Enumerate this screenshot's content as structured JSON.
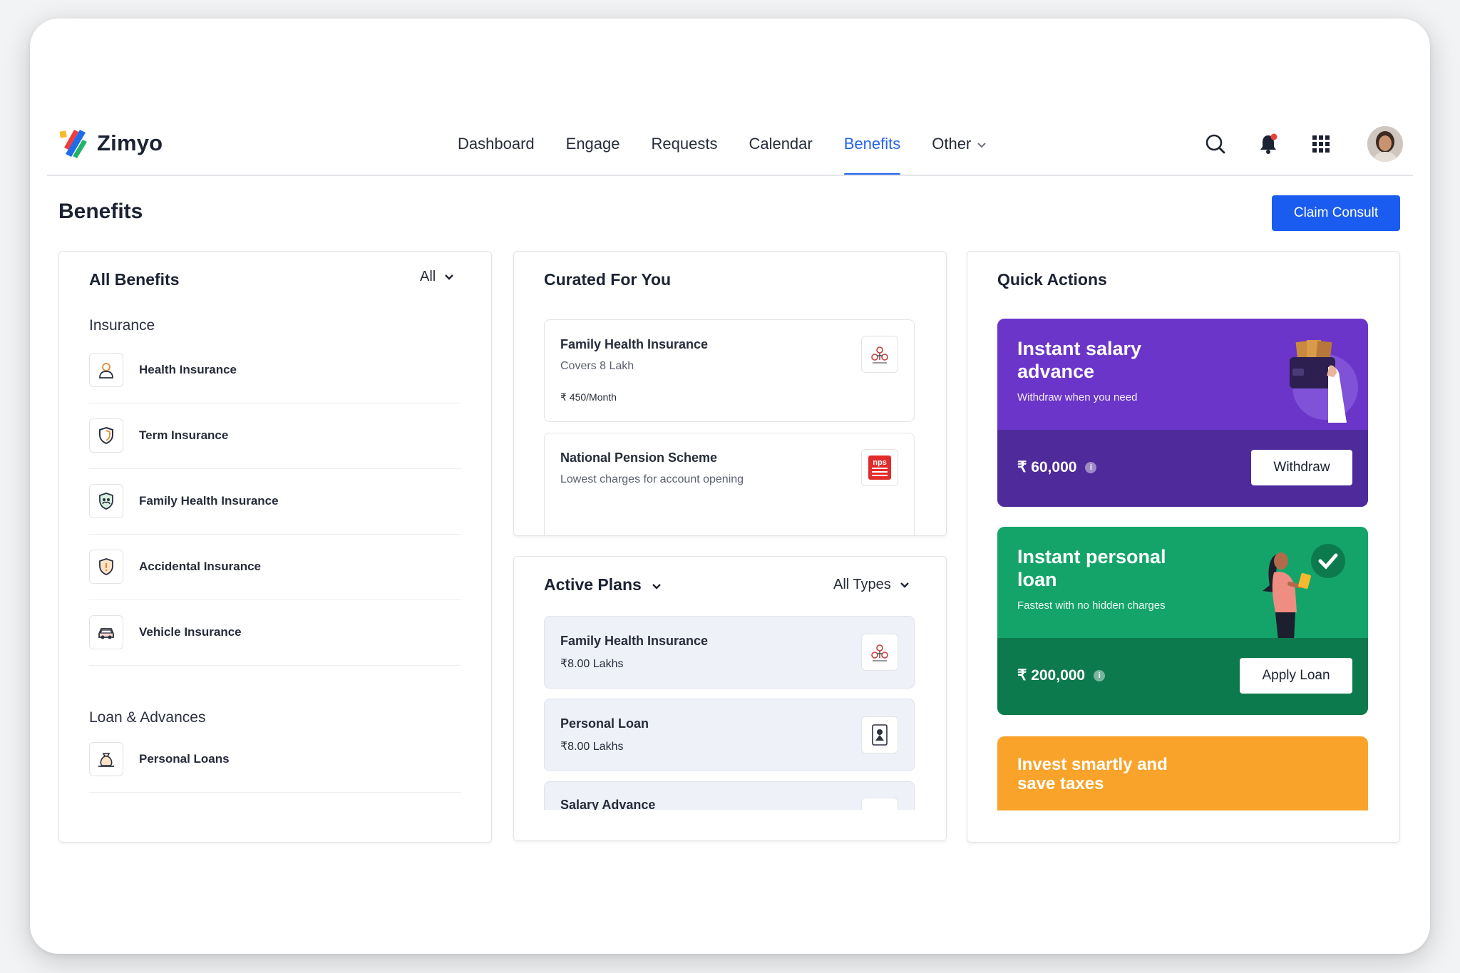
{
  "brand": {
    "name": "Zimyo"
  },
  "nav": {
    "items": [
      {
        "label": "Dashboard"
      },
      {
        "label": "Engage"
      },
      {
        "label": "Requests"
      },
      {
        "label": "Calendar"
      },
      {
        "label": "Benefits"
      },
      {
        "label": "Other"
      }
    ],
    "active_index": 4
  },
  "page": {
    "title": "Benefits",
    "claim_button": "Claim Consult"
  },
  "all_benefits": {
    "title": "All Benefits",
    "filter": "All",
    "sections": [
      {
        "label": "Insurance",
        "items": [
          "Health Insurance",
          "Term Insurance",
          "Family Health Insurance",
          "Accidental Insurance",
          "Vehicle Insurance"
        ]
      },
      {
        "label": "Loan & Advances",
        "items": [
          "Personal Loans"
        ]
      }
    ]
  },
  "curated": {
    "title": "Curated For You",
    "items": [
      {
        "name": "Family Health Insurance",
        "sub": "Covers 8 Lakh",
        "price": "₹ 450/Month",
        "logo": "risk-covery-logo"
      },
      {
        "name": "National Pension Scheme",
        "sub": "Lowest charges for account opening",
        "logo": "nps-logo"
      }
    ]
  },
  "active_plans": {
    "title": "Active Plans",
    "filter": "All Types",
    "items": [
      {
        "name": "Family Health Insurance",
        "value": "₹8.00 Lakhs"
      },
      {
        "name": "Personal Loan",
        "value": "₹8.00 Lakhs"
      },
      {
        "name": "Salary Advance",
        "value": ""
      }
    ]
  },
  "quick_actions": {
    "title": "Quick Actions",
    "cards": [
      {
        "title": "Instant salary advance",
        "subtitle": "Withdraw when you need",
        "amount": "₹ 60,000",
        "button": "Withdraw",
        "color": "#6b35c9",
        "dark": "#4f2a9a"
      },
      {
        "title": "Instant personal loan",
        "subtitle": "Fastest with no hidden charges",
        "amount": "₹ 200,000",
        "button": "Apply Loan",
        "color": "#14a46a",
        "dark": "#0d7a4d"
      },
      {
        "title": "Invest smartly and save taxes",
        "color": "#f9a32a"
      }
    ]
  }
}
